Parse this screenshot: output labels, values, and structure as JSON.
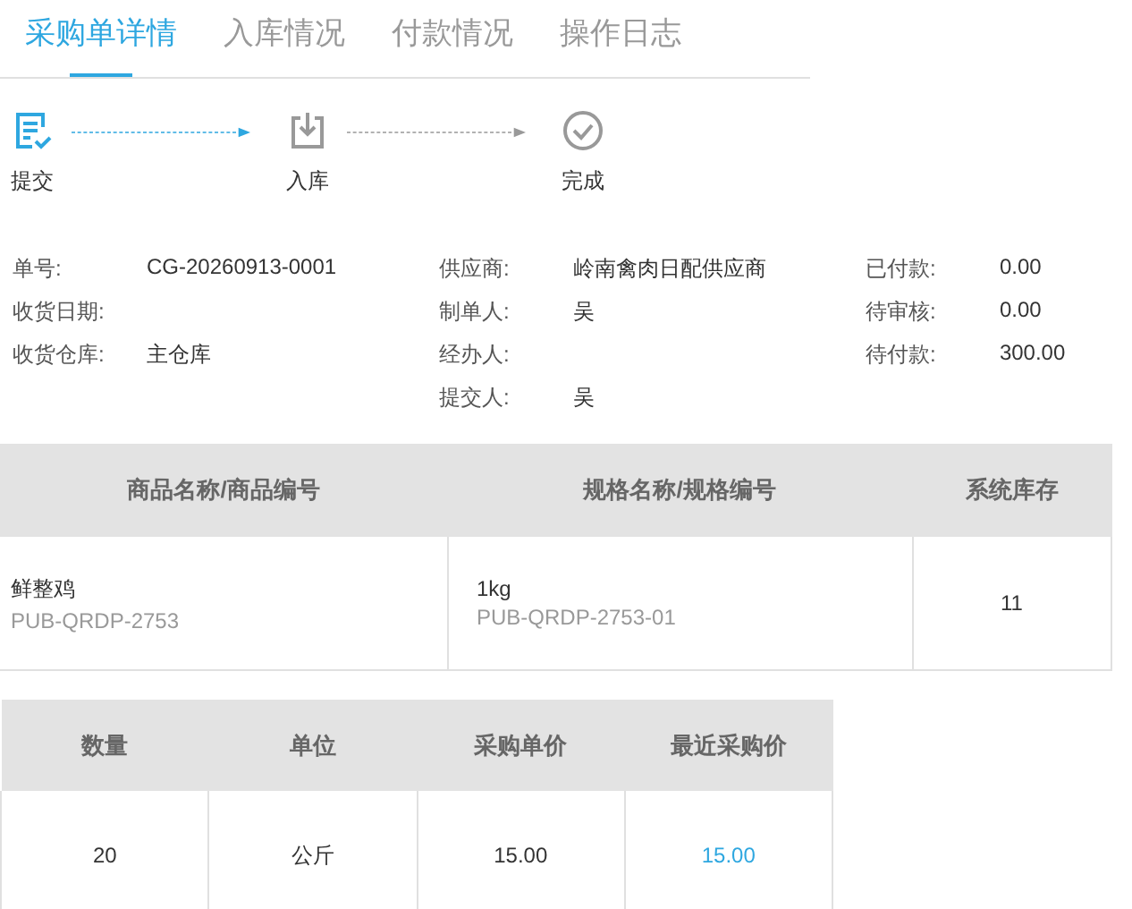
{
  "tabs": [
    {
      "label": "采购单详情",
      "selected": true
    },
    {
      "label": "入库情况",
      "selected": false
    },
    {
      "label": "付款情况",
      "selected": false
    },
    {
      "label": "操作日志",
      "selected": false
    }
  ],
  "steps": [
    {
      "label": "提交",
      "kind": "submit",
      "done": true
    },
    {
      "label": "入库",
      "kind": "inbound",
      "done": false
    },
    {
      "label": "完成",
      "kind": "complete",
      "done": false
    }
  ],
  "info_columns": [
    [
      {
        "label": "单号:",
        "value": "CG-20260913-0001"
      },
      {
        "label": "收货日期:"
      },
      {
        "label": "收货仓库:",
        "value": "主仓库"
      }
    ],
    [
      {
        "label": "供应商:",
        "value": "岭南禽肉日配供应商"
      },
      {
        "label": "制单人:",
        "value": "吴"
      },
      {
        "label": "经办人:"
      },
      {
        "label": "提交人:",
        "value": "吴"
      }
    ],
    [
      {
        "label": "已付款:",
        "value": "0.00"
      },
      {
        "label": "待审核:",
        "value": "0.00"
      },
      {
        "label": "待付款:",
        "value": "300.00"
      }
    ]
  ],
  "product_table": {
    "columns": [
      "商品名称/商品编号",
      "规格名称/规格编号",
      "系统库存"
    ],
    "rows": [
      [
        {
          "main": "鲜整鸡",
          "sub": "PUB-QRDP-2753"
        },
        {
          "main": "1kg",
          "sub": "PUB-QRDP-2753-01"
        },
        {
          "main": "11"
        }
      ]
    ]
  },
  "quantity_table": {
    "columns": [
      "数量",
      "单位",
      "采购单价",
      "最近采购价"
    ],
    "rows": [
      [
        {
          "text": "20",
          "link": false
        },
        {
          "text": "公斤",
          "link": false
        },
        {
          "text": "15.00",
          "link": false
        },
        {
          "text": "15.00",
          "link": true
        }
      ]
    ]
  }
}
